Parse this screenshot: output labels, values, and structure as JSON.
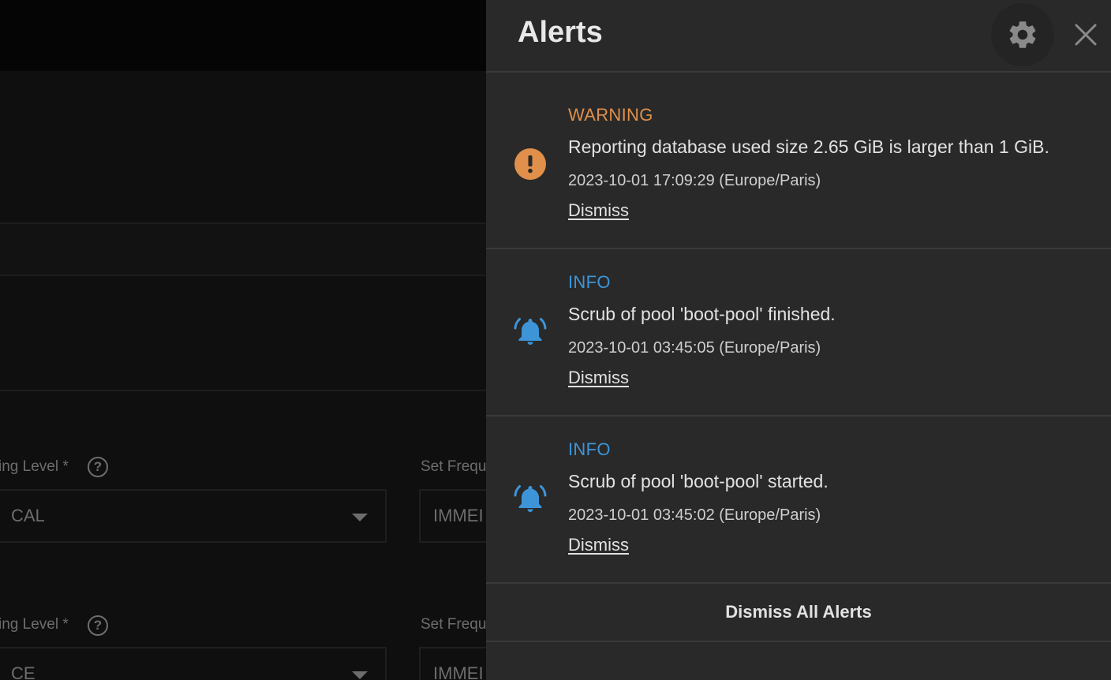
{
  "background": {
    "rows": [
      {
        "label": "ing Level *",
        "select_value": "CAL",
        "frequency_label": "Set Frequ",
        "frequency_value": "IMMEI"
      },
      {
        "label": "ing Level *",
        "select_value": "CE",
        "frequency_label": "Set Frequ",
        "frequency_value": "IMMEI"
      }
    ],
    "help_glyph": "?"
  },
  "panel": {
    "title": "Alerts",
    "settings_icon": "gear-icon",
    "close_icon": "close-icon"
  },
  "alerts": [
    {
      "level": "WARNING",
      "level_color": "#e0904a",
      "icon": "warning-circle-icon",
      "message": "Reporting database used size 2.65 GiB is larger than 1 GiB.",
      "timestamp": "2023-10-01 17:09:29 (Europe/Paris)",
      "dismiss_label": "Dismiss"
    },
    {
      "level": "INFO",
      "level_color": "#3d95d8",
      "icon": "bell-ringing-icon",
      "message": "Scrub of pool 'boot-pool' finished.",
      "timestamp": "2023-10-01 03:45:05 (Europe/Paris)",
      "dismiss_label": "Dismiss"
    },
    {
      "level": "INFO",
      "level_color": "#3d95d8",
      "icon": "bell-ringing-icon",
      "message": "Scrub of pool 'boot-pool' started.",
      "timestamp": "2023-10-01 03:45:02 (Europe/Paris)",
      "dismiss_label": "Dismiss"
    }
  ],
  "dismiss_all_label": "Dismiss All Alerts"
}
